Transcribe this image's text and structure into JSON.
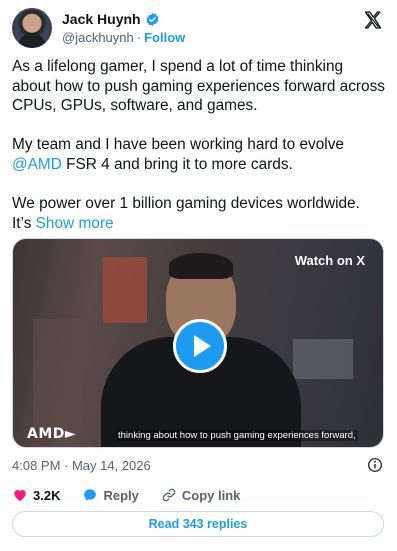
{
  "author": {
    "name": "Jack Huynh",
    "handle": "@jackhuynh",
    "separator": "·",
    "follow_label": "Follow"
  },
  "post": {
    "paragraph1": "As a lifelong gamer, I spend a lot of time thinking about how to push gaming experiences forward across CPUs, GPUs, software, and games.",
    "paragraph2_prefix": "My team and I have been working hard to evolve ",
    "paragraph2_mention": "@AMD",
    "paragraph2_suffix": " FSR 4 and bring it to more cards.",
    "paragraph3": "We power over 1 billion gaming devices worldwide.",
    "paragraph4_prefix": "It’s ",
    "show_more_label": "Show more"
  },
  "media": {
    "watch_label": "Watch on X",
    "brand_text": "AMD►",
    "caption": "thinking about how to push gaming experiences forward,"
  },
  "meta": {
    "timestamp": "4:08 PM · May 14, 2026"
  },
  "actions": {
    "likes_count": "3.2K",
    "reply_label": "Reply",
    "copy_link_label": "Copy link"
  },
  "replies_button": {
    "label": "Read 343 replies"
  },
  "colors": {
    "accent": "#1d9bf0",
    "like": "#f91880",
    "text": "#0f1419",
    "muted": "#536471",
    "border": "#cfd9de"
  },
  "icons": [
    "verified-badge-icon",
    "x-logo-icon",
    "play-icon",
    "info-icon",
    "heart-icon",
    "reply-bubble-icon",
    "link-icon"
  ]
}
